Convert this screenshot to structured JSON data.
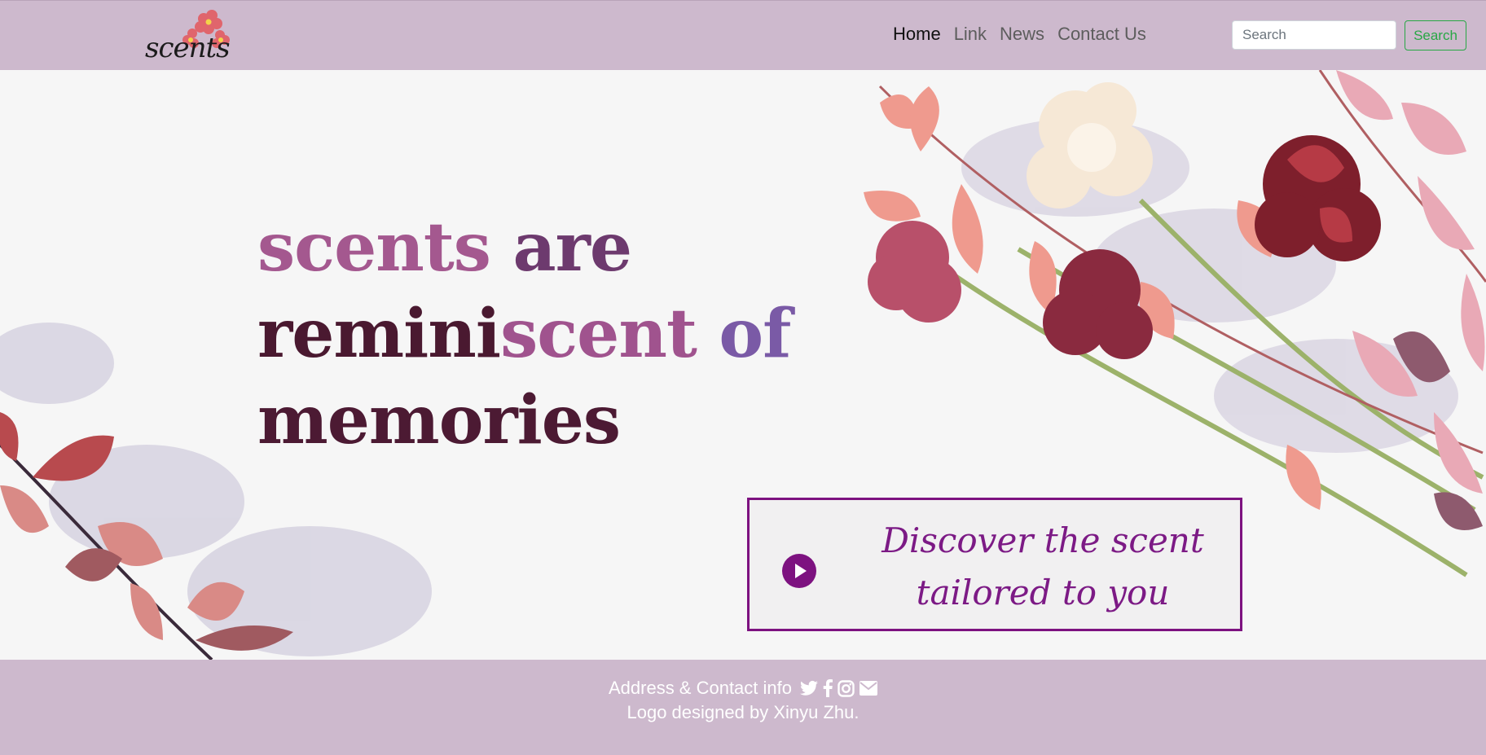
{
  "navbar": {
    "logo_text": "scents",
    "links": [
      {
        "label": "Home",
        "active": true
      },
      {
        "label": "Link",
        "active": false
      },
      {
        "label": "News",
        "active": false
      },
      {
        "label": "Contact Us",
        "active": false
      }
    ],
    "search": {
      "placeholder": "Search",
      "button_label": "Search"
    }
  },
  "hero": {
    "headline": {
      "line1": {
        "scents": "scents",
        "are": " are"
      },
      "line2": {
        "remini": "remini",
        "scent": "scent",
        "of": " of"
      },
      "line3": "memories"
    },
    "cta": {
      "line1": "Discover the scent",
      "line2": "tailored to you"
    }
  },
  "footer": {
    "contact_text": "Address & Contact info",
    "credit_text": "Logo designed by Xinyu Zhu."
  },
  "colors": {
    "navbar_bg": "#cdb9cd",
    "accent_purple": "#7d1280",
    "search_green": "#28a745"
  },
  "icons": [
    "flower-logo-icon",
    "play-icon",
    "twitter-icon",
    "facebook-icon",
    "instagram-icon",
    "mail-icon"
  ]
}
